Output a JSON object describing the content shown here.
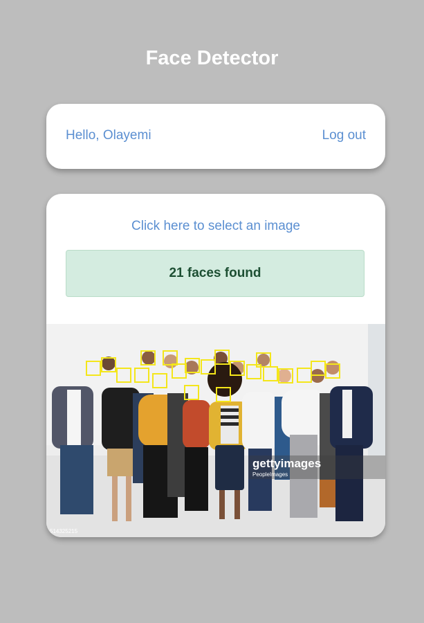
{
  "app": {
    "title": "Face Detector"
  },
  "header": {
    "greeting": "Hello, Olayemi",
    "logout_label": "Log out"
  },
  "main": {
    "select_label": "Click here to select an image",
    "result_text": "21 faces found",
    "photo": {
      "watermark": "gettyimages",
      "watermark_sub": "PeopleImages",
      "image_id": "514325215",
      "face_count": 21
    }
  },
  "colors": {
    "background": "#bdbdbd",
    "link": "#5b8fd1",
    "success_bg": "#d4ece0",
    "success_text": "#1d4f33",
    "face_box": "#f4e61a"
  }
}
